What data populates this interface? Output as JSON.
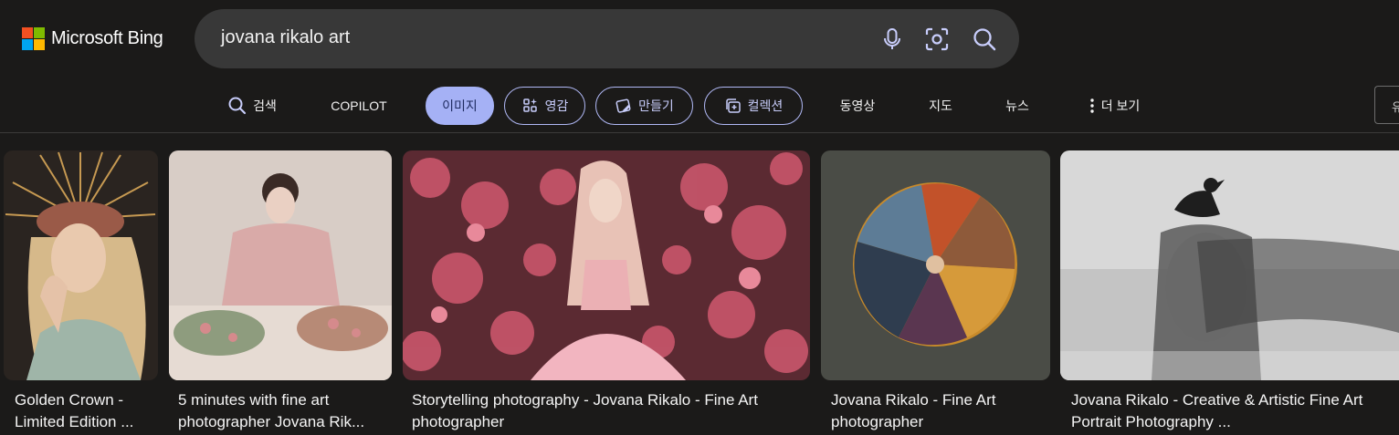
{
  "header": {
    "logo_text": "Microsoft Bing",
    "search_value": "jovana rikalo art"
  },
  "nav": {
    "items": [
      {
        "label": "검색"
      },
      {
        "label": "COPILOT"
      },
      {
        "label": "이미지"
      },
      {
        "label": "영감"
      },
      {
        "label": "만들기"
      },
      {
        "label": "컬렉션"
      },
      {
        "label": "동영상"
      },
      {
        "label": "지도"
      },
      {
        "label": "뉴스"
      },
      {
        "label": "더 보기"
      }
    ],
    "edge_label": "유"
  },
  "results": [
    {
      "caption_line1": "Golden Crown -",
      "caption_line2": "Limited Edition ..."
    },
    {
      "caption_line1": "5 minutes with fine art",
      "caption_line2": "photographer Jovana Rik..."
    },
    {
      "caption_line1": "Storytelling photography - Jovana Rikalo - Fine Art",
      "caption_line2": "photographer"
    },
    {
      "caption_line1": "Jovana Rikalo - Fine Art",
      "caption_line2": "photographer"
    },
    {
      "caption_line1": "Jovana Rikalo - Creative & Artistic Fine Art",
      "caption_line2": "Portrait Photography ..."
    }
  ],
  "colors": {
    "background": "#1b1a19",
    "search_box": "#383838",
    "active_pill": "#a5b1f5",
    "pill_border": "#b0b8f5"
  }
}
